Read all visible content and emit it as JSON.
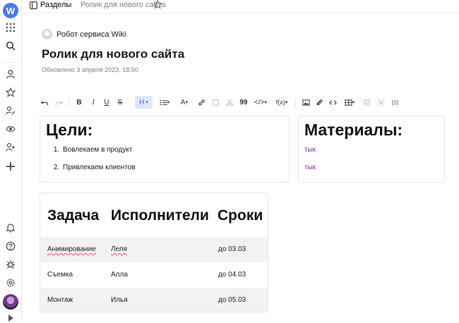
{
  "app": {
    "logo_letter": "W"
  },
  "topbar": {
    "sections_label": "Разделы",
    "page_crumb": "Ролик для нового сайта"
  },
  "author": {
    "name": "Робот сервиса Wiki"
  },
  "page": {
    "title": "Ролик для нового сайта",
    "updated": "Обновлено 3 апреля 2023, 18:50"
  },
  "toolbar": {
    "bold": "B",
    "italic": "I",
    "underline": "U",
    "strike": "S",
    "heading": "H",
    "text_color": "A",
    "quote": "99",
    "formula": "f(x)"
  },
  "goals": {
    "heading": "Цели:",
    "items": [
      "Вовлекаем в продукт",
      "Привлекаем клиентов"
    ]
  },
  "materials": {
    "heading": "Материалы:",
    "links": [
      "тык",
      "тык"
    ]
  },
  "table": {
    "headers": [
      "Задача",
      "Исполнители",
      "Сроки"
    ],
    "rows": [
      [
        "Анимирование",
        "Леля",
        "до 03.03"
      ],
      [
        "Съемка",
        "Алла",
        "до 04.03"
      ],
      [
        "Монтаж",
        "Илья",
        "до 05.03"
      ]
    ]
  },
  "colors": {
    "accent": "#4b7be5",
    "link": "#7a2ca8",
    "heading_active_bg": "#dde8fb"
  }
}
